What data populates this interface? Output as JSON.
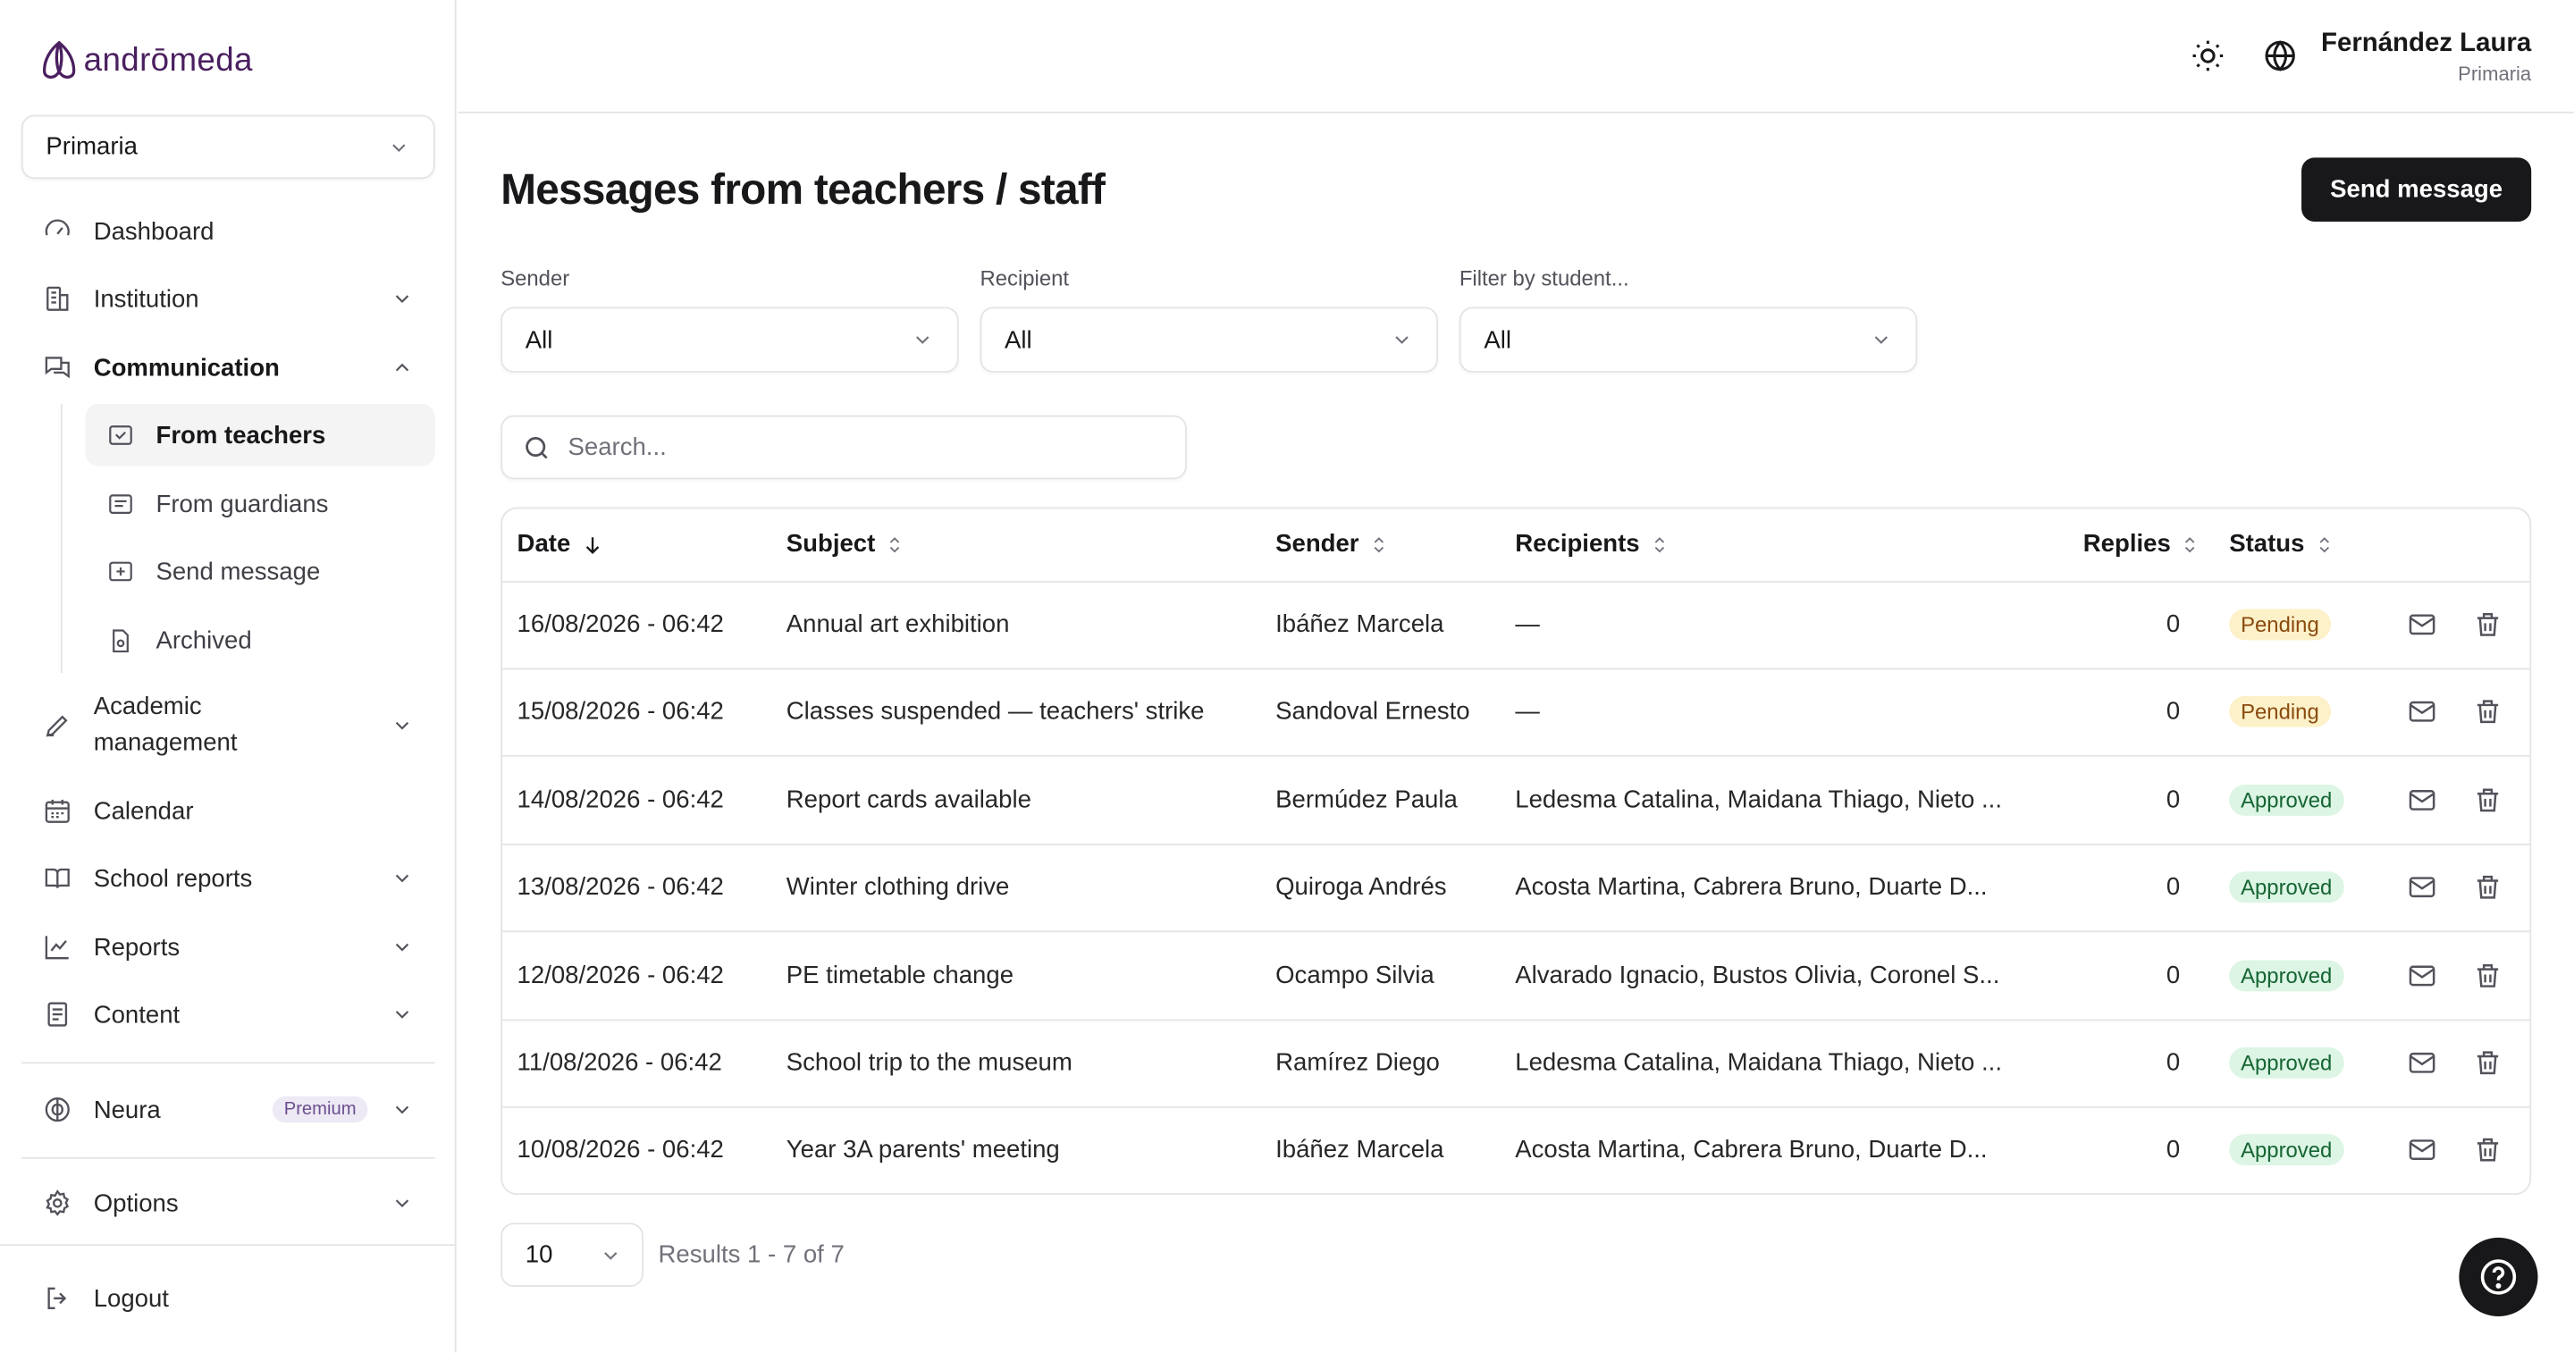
{
  "brand": {
    "name": "andrōmeda"
  },
  "school_selector": {
    "value": "Primaria"
  },
  "nav": {
    "dashboard": "Dashboard",
    "institution": "Institution",
    "communication": "Communication",
    "sub": {
      "from_teachers": "From teachers",
      "from_guardians": "From guardians",
      "send_message": "Send message",
      "archived": "Archived"
    },
    "academic_line1": "Academic",
    "academic_line2": "management",
    "calendar": "Calendar",
    "school_reports": "School reports",
    "reports": "Reports",
    "content": "Content",
    "neura": "Neura",
    "neura_badge": "Premium",
    "options": "Options",
    "logout": "Logout"
  },
  "user": {
    "name": "Fernández Laura",
    "role": "Primaria"
  },
  "page": {
    "title": "Messages from teachers / staff",
    "send_button": "Send message"
  },
  "filters": {
    "sender": {
      "label": "Sender",
      "value": "All"
    },
    "recipient": {
      "label": "Recipient",
      "value": "All"
    },
    "student": {
      "label": "Filter by student...",
      "value": "All"
    }
  },
  "search": {
    "placeholder": "Search..."
  },
  "table": {
    "columns": {
      "date": "Date",
      "subject": "Subject",
      "sender": "Sender",
      "recipients": "Recipients",
      "replies": "Replies",
      "status": "Status"
    },
    "rows": [
      {
        "date": "16/08/2026 - 06:42",
        "subject": "Annual art exhibition",
        "sender": "Ibáñez Marcela",
        "recipients": "—",
        "replies": "0",
        "status": "Pending"
      },
      {
        "date": "15/08/2026 - 06:42",
        "subject": "Classes suspended — teachers' strike",
        "sender": "Sandoval Ernesto",
        "recipients": "—",
        "replies": "0",
        "status": "Pending"
      },
      {
        "date": "14/08/2026 - 06:42",
        "subject": "Report cards available",
        "sender": "Bermúdez Paula",
        "recipients": "Ledesma Catalina, Maidana Thiago, Nieto ...",
        "replies": "0",
        "status": "Approved"
      },
      {
        "date": "13/08/2026 - 06:42",
        "subject": "Winter clothing drive",
        "sender": "Quiroga Andrés",
        "recipients": "Acosta Martina, Cabrera Bruno, Duarte D...",
        "replies": "0",
        "status": "Approved"
      },
      {
        "date": "12/08/2026 - 06:42",
        "subject": "PE timetable change",
        "sender": "Ocampo Silvia",
        "recipients": "Alvarado Ignacio, Bustos Olivia, Coronel S...",
        "replies": "0",
        "status": "Approved"
      },
      {
        "date": "11/08/2026 - 06:42",
        "subject": "School trip to the museum",
        "sender": "Ramírez Diego",
        "recipients": "Ledesma Catalina, Maidana Thiago, Nieto ...",
        "replies": "0",
        "status": "Approved"
      },
      {
        "date": "10/08/2026 - 06:42",
        "subject": "Year 3A parents' meeting",
        "sender": "Ibáñez Marcela",
        "recipients": "Acosta Martina, Cabrera Bruno, Duarte D...",
        "replies": "0",
        "status": "Approved"
      }
    ]
  },
  "pagination": {
    "page_size": "10",
    "results_text": "Results 1 - 7 of 7"
  },
  "colors": {
    "primary": "#18181b",
    "brand": "#4a1f5f",
    "pending_bg": "#fdf1c9",
    "approved_bg": "#dcf5e4"
  }
}
